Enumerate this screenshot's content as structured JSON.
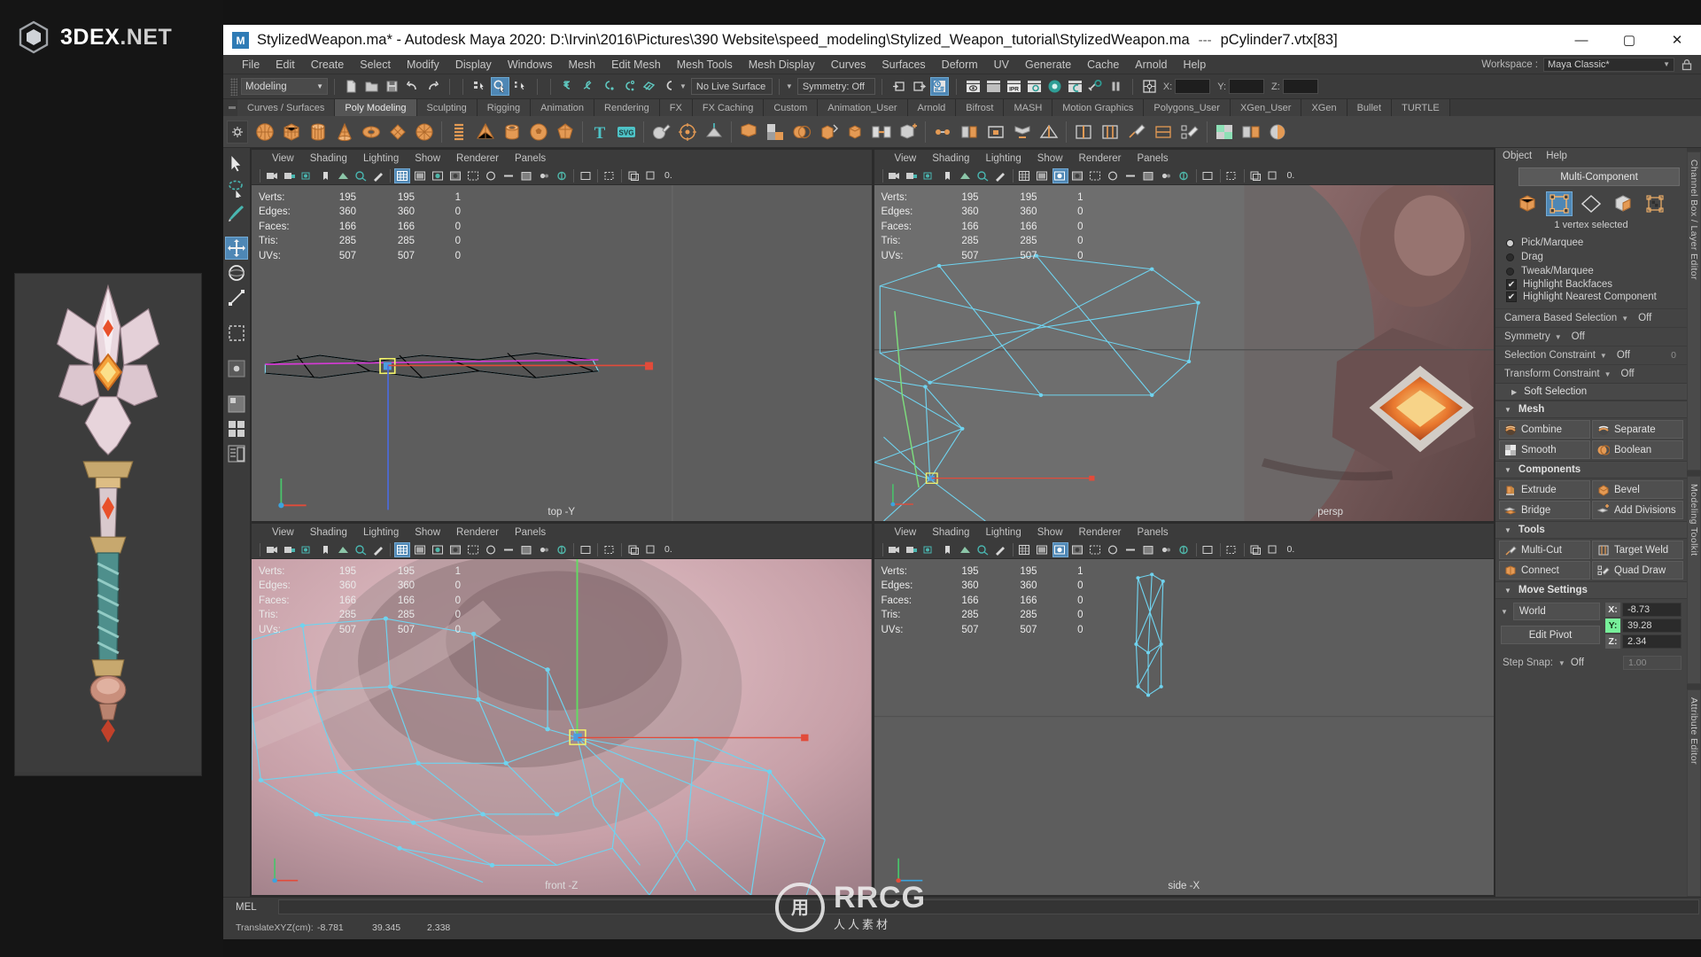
{
  "brand": {
    "name_bold": "3DEX",
    "name_rest": ".NET",
    "logo_icon": "hex-cube-icon"
  },
  "watermark": {
    "mark": "RRCG",
    "text": "RRCG",
    "sub": "人人素材"
  },
  "titlebar": {
    "icon": "maya-app-icon",
    "text": "StylizedWeapon.ma* - Autodesk Maya 2020: D:\\Irvin\\2016\\Pictures\\390 Website\\speed_modeling\\Stylized_Weapon_tutorial\\StylizedWeapon.ma",
    "separator": "---",
    "selection": "pCylinder7.vtx[83]",
    "minimize": "—",
    "maximize": "▢",
    "close": "✕"
  },
  "menubar": {
    "items": [
      "File",
      "Edit",
      "Create",
      "Select",
      "Modify",
      "Display",
      "Windows",
      "Mesh",
      "Edit Mesh",
      "Mesh Tools",
      "Mesh Display",
      "Curves",
      "Surfaces",
      "Deform",
      "UV",
      "Generate",
      "Cache",
      "Arnold",
      "Help"
    ],
    "workspace_label": "Workspace :",
    "workspace_value": "Maya Classic*",
    "lock_icon": "lock-icon"
  },
  "statusline": {
    "mode": "Modeling",
    "new_icon": "new-scene-icon",
    "open_icon": "open-scene-icon",
    "save_icon": "save-scene-icon",
    "undo_icon": "undo-icon",
    "redo_icon": "redo-icon",
    "sel_hierarchy_icon": "select-hierarchy-icon",
    "sel_object_icon": "select-object-icon",
    "sel_component_icon": "select-component-icon",
    "snap_grid_icon": "snap-to-grid-icon",
    "snap_curve_icon": "snap-to-curve-icon",
    "snap_point_icon": "snap-to-point-icon",
    "snap_projected_icon": "snap-to-projected-center-icon",
    "snap_view_icon": "snap-to-view-plane-icon",
    "magnet_icon": "make-live-icon",
    "live_surface": "No Live Surface",
    "symmetry": "Symmetry: Off",
    "history_in_icon": "input-connections-icon",
    "history_out_icon": "output-connections-icon",
    "list_icon": "construction-history-icon",
    "render_view_icon": "render-view-icon",
    "render_frame_icon": "render-current-frame-icon",
    "ipr_icon": "ipr-render-icon",
    "render_settings_icon": "render-settings-icon",
    "hypershade_icon": "hypershade-icon",
    "render_setup_icon": "render-setup-icon",
    "light_editor_icon": "light-editor-icon",
    "pause_icon": "pause-viewport-icon",
    "sel_mask_icon": "selection-mask-icon",
    "x_label": "X:",
    "y_label": "Y:",
    "z_label": "Z:",
    "x_value": "",
    "y_value": "",
    "z_value": ""
  },
  "shelf": {
    "tabs": [
      "Curves / Surfaces",
      "Poly Modeling",
      "Sculpting",
      "Rigging",
      "Animation",
      "Rendering",
      "FX",
      "FX Caching",
      "Custom",
      "Animation_User",
      "Arnold",
      "Bifrost",
      "MASH",
      "Motion Graphics",
      "Polygons_User",
      "XGen_User",
      "XGen",
      "Bullet",
      "TURTLE"
    ],
    "selected_tab": "Poly Modeling",
    "icons": [
      "poly-sphere-icon",
      "poly-cube-icon",
      "poly-cylinder-icon",
      "poly-cone-icon",
      "poly-torus-icon",
      "poly-plane-icon",
      "poly-prism-icon",
      "poly-helix-icon",
      "poly-pyramid-icon",
      "poly-pipe-icon",
      "poly-soccerball-icon",
      "poly-platonic-icon",
      "text-icon",
      "svg-icon",
      "sculpt-icon",
      "poly-combine-icon",
      "poly-smooth-icon",
      "poly-booleans-icon",
      "poly-extrude-icon",
      "poly-bevel-icon",
      "poly-bridge-icon",
      "poly-append-icon",
      "poly-merge-icon",
      "poly-multicut-icon",
      "poly-target-weld-icon",
      "poly-quad-draw-icon",
      "poly-insert-edge-loop-icon",
      "poly-offset-edge-loop-icon",
      "poly-connect-icon",
      "poly-crease-icon",
      "poly-mirror-icon",
      "poly-reduce-icon",
      "poly-triangulate-icon",
      "poly-quadrangulate-icon",
      "poly-retopo-icon",
      "uv-editor-icon",
      "normals-icon",
      "color-set-icon"
    ]
  },
  "toolbox": {
    "items": [
      "select-tool-icon",
      "lasso-select-tool-icon",
      "paint-select-tool-icon",
      "move-tool-icon",
      "rotate-tool-icon",
      "scale-tool-icon",
      "last-tool-icon",
      "show-manipulator-icon",
      "view-layout-four-icon",
      "view-layout-persp-icon",
      "view-layout-outliner-icon"
    ],
    "selected": "move-tool-icon"
  },
  "viewports": [
    {
      "name": "top-view",
      "menus": [
        "View",
        "Shading",
        "Lighting",
        "Show",
        "Renderer",
        "Panels"
      ],
      "stats": {
        "rows": [
          {
            "label": "Verts:",
            "c1": "195",
            "c2": "195",
            "c3": "1"
          },
          {
            "label": "Edges:",
            "c1": "360",
            "c2": "360",
            "c3": "0"
          },
          {
            "label": "Faces:",
            "c1": "166",
            "c2": "166",
            "c3": "0"
          },
          {
            "label": "Tris:",
            "c1": "285",
            "c2": "285",
            "c3": "0"
          },
          {
            "label": "UVs:",
            "c1": "507",
            "c2": "507",
            "c3": "0"
          }
        ]
      },
      "label": "top -Y"
    },
    {
      "name": "persp-view",
      "menus": [
        "View",
        "Shading",
        "Lighting",
        "Show",
        "Renderer",
        "Panels"
      ],
      "stats": {
        "rows": [
          {
            "label": "Verts:",
            "c1": "195",
            "c2": "195",
            "c3": "1"
          },
          {
            "label": "Edges:",
            "c1": "360",
            "c2": "360",
            "c3": "0"
          },
          {
            "label": "Faces:",
            "c1": "166",
            "c2": "166",
            "c3": "0"
          },
          {
            "label": "Tris:",
            "c1": "285",
            "c2": "285",
            "c3": "0"
          },
          {
            "label": "UVs:",
            "c1": "507",
            "c2": "507",
            "c3": "0"
          }
        ]
      },
      "label": "persp"
    },
    {
      "name": "front-view",
      "menus": [
        "View",
        "Shading",
        "Lighting",
        "Show",
        "Renderer",
        "Panels"
      ],
      "stats": {
        "rows": [
          {
            "label": "Verts:",
            "c1": "195",
            "c2": "195",
            "c3": "1"
          },
          {
            "label": "Edges:",
            "c1": "360",
            "c2": "360",
            "c3": "0"
          },
          {
            "label": "Faces:",
            "c1": "166",
            "c2": "166",
            "c3": "0"
          },
          {
            "label": "Tris:",
            "c1": "285",
            "c2": "285",
            "c3": "0"
          },
          {
            "label": "UVs:",
            "c1": "507",
            "c2": "507",
            "c3": "0"
          }
        ]
      },
      "label": "front -Z"
    },
    {
      "name": "side-view",
      "menus": [
        "View",
        "Shading",
        "Lighting",
        "Show",
        "Renderer",
        "Panels"
      ],
      "stats": {
        "rows": [
          {
            "label": "Verts:",
            "c1": "195",
            "c2": "195",
            "c3": "1"
          },
          {
            "label": "Edges:",
            "c1": "360",
            "c2": "360",
            "c3": "0"
          },
          {
            "label": "Faces:",
            "c1": "166",
            "c2": "166",
            "c3": "0"
          },
          {
            "label": "Tris:",
            "c1": "285",
            "c2": "285",
            "c3": "0"
          },
          {
            "label": "UVs:",
            "c1": "507",
            "c2": "507",
            "c3": "0"
          }
        ]
      },
      "label": "side -X"
    }
  ],
  "toolkit": {
    "menus": [
      "Object",
      "Help"
    ],
    "multi_component_button": "Multi-Component",
    "component_modes": [
      {
        "icon": "object-mode-icon",
        "selected": false
      },
      {
        "icon": "vertex-mode-icon",
        "selected": true
      },
      {
        "icon": "edge-mode-icon",
        "selected": false
      },
      {
        "icon": "face-mode-icon",
        "selected": false
      },
      {
        "icon": "uv-mode-icon",
        "selected": false
      }
    ],
    "selection_caption": "1 vertex selected",
    "radios": [
      {
        "label": "Pick/Marquee",
        "on": true
      },
      {
        "label": "Drag",
        "on": false
      },
      {
        "label": "Tweak/Marquee",
        "on": false
      }
    ],
    "checks": [
      {
        "label": "Highlight Backfaces",
        "on": true
      },
      {
        "label": "Highlight Nearest Component",
        "on": true
      }
    ],
    "options": [
      {
        "label": "Camera Based Selection",
        "value": "Off",
        "extra": ""
      },
      {
        "label": "Symmetry",
        "value": "Off",
        "extra": ""
      },
      {
        "label": "Selection Constraint",
        "value": "Off",
        "extra": "0"
      },
      {
        "label": "Transform Constraint",
        "value": "Off",
        "extra": ""
      }
    ],
    "soft_selection": {
      "title": "Soft Selection",
      "expanded": false
    },
    "sections": [
      {
        "title": "Mesh",
        "expanded": true,
        "buttons": [
          {
            "label": "Combine",
            "icon": "mesh-combine-icon"
          },
          {
            "label": "Separate",
            "icon": "mesh-separate-icon"
          },
          {
            "label": "Smooth",
            "icon": "mesh-smooth-icon"
          },
          {
            "label": "Boolean",
            "icon": "mesh-boolean-icon"
          }
        ]
      },
      {
        "title": "Components",
        "expanded": true,
        "buttons": [
          {
            "label": "Extrude",
            "icon": "extrude-icon"
          },
          {
            "label": "Bevel",
            "icon": "bevel-icon"
          },
          {
            "label": "Bridge",
            "icon": "bridge-icon"
          },
          {
            "label": "Add Divisions",
            "icon": "add-divisions-icon"
          }
        ]
      },
      {
        "title": "Tools",
        "expanded": true,
        "buttons": [
          {
            "label": "Multi-Cut",
            "icon": "multi-cut-icon"
          },
          {
            "label": "Target Weld",
            "icon": "target-weld-icon"
          },
          {
            "label": "Connect",
            "icon": "connect-icon"
          },
          {
            "label": "Quad Draw",
            "icon": "quad-draw-icon"
          }
        ]
      }
    ],
    "move_settings": {
      "title": "Move Settings",
      "space": "World",
      "edit_pivot": "Edit Pivot",
      "axes": [
        {
          "key": "X:",
          "value": "-8.73",
          "highlight": false
        },
        {
          "key": "Y:",
          "value": "39.28",
          "highlight": true
        },
        {
          "key": "Z:",
          "value": "2.34",
          "highlight": false
        }
      ],
      "step_snap_label": "Step Snap:",
      "step_snap_value": "Off",
      "step_snap_number": "1.00"
    }
  },
  "dock_tabs": [
    "Channel Box / Layer Editor",
    "Modeling Toolkit",
    "Attribute Editor"
  ],
  "command_line": {
    "mel_label": "MEL",
    "value": ""
  },
  "help_line": {
    "label": "TranslateXYZ(cm):",
    "x": "-8.781",
    "y": "39.345",
    "z": "2.338"
  },
  "colors": {
    "accent_blue": "#4e87b5",
    "panel_bg": "#444444",
    "viewport_bg": "#5d5d5d",
    "highlight_green": "#77f09a",
    "mesh_wire": "#5ec8e8",
    "orange_icon": "#e08a43"
  }
}
